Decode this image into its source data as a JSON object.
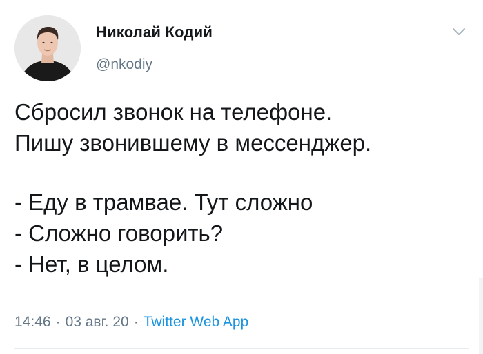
{
  "author": {
    "name": "Николай Кодий",
    "handle": "@nkodiy",
    "avatar_icon": "user-avatar-photo"
  },
  "tweet": {
    "lines": [
      "Сбросил звонок на телефоне.",
      "Пишу звонившему в мессенджер.",
      "",
      "- Еду в трамвае. Тут сложно",
      "- Сложно говорить?",
      "- Нет, в целом."
    ]
  },
  "meta": {
    "time": "14:46",
    "date": "03 авг. 20",
    "separator": "·",
    "source": "Twitter Web App"
  },
  "icons": {
    "more": "chevron-down-icon"
  },
  "colors": {
    "text": "#14171a",
    "secondary": "#657786",
    "link": "#1b95e0",
    "divider": "#e6ecf0"
  }
}
